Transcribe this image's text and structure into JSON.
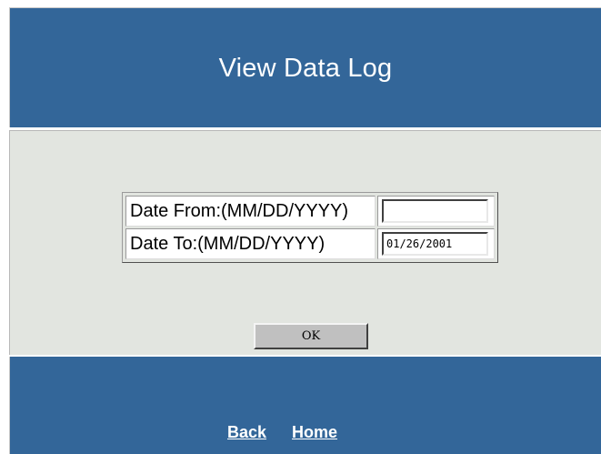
{
  "header": {
    "title": "View Data Log"
  },
  "form": {
    "date_from": {
      "label": "Date From:(MM/DD/YYYY)",
      "value": ""
    },
    "date_to": {
      "label": "Date To:(MM/DD/YYYY)",
      "value": "01/26/2001"
    },
    "ok_label": "OK"
  },
  "footer": {
    "back_label": "Back",
    "home_label": "Home"
  },
  "colors": {
    "banner": "#336699",
    "panel": "#e2e5e0",
    "button": "#c0c0c0"
  }
}
